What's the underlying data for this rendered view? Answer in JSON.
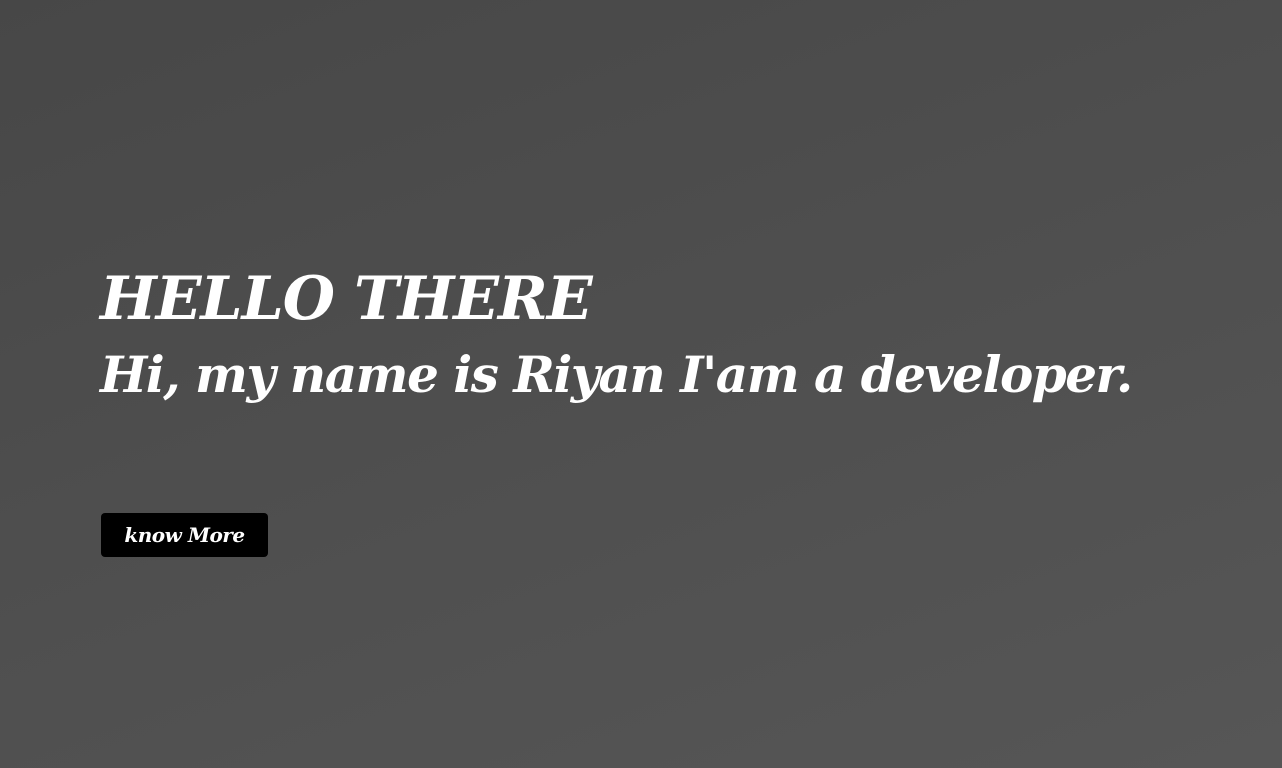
{
  "hero": {
    "greeting": "HELLO THERE",
    "intro": "Hi, my name is Riyan I'am a developer.",
    "cta_label": "know More"
  },
  "colors": {
    "background_top": "#474747",
    "background_bottom": "#565656",
    "text": "#ffffff",
    "button_bg": "#000000"
  }
}
